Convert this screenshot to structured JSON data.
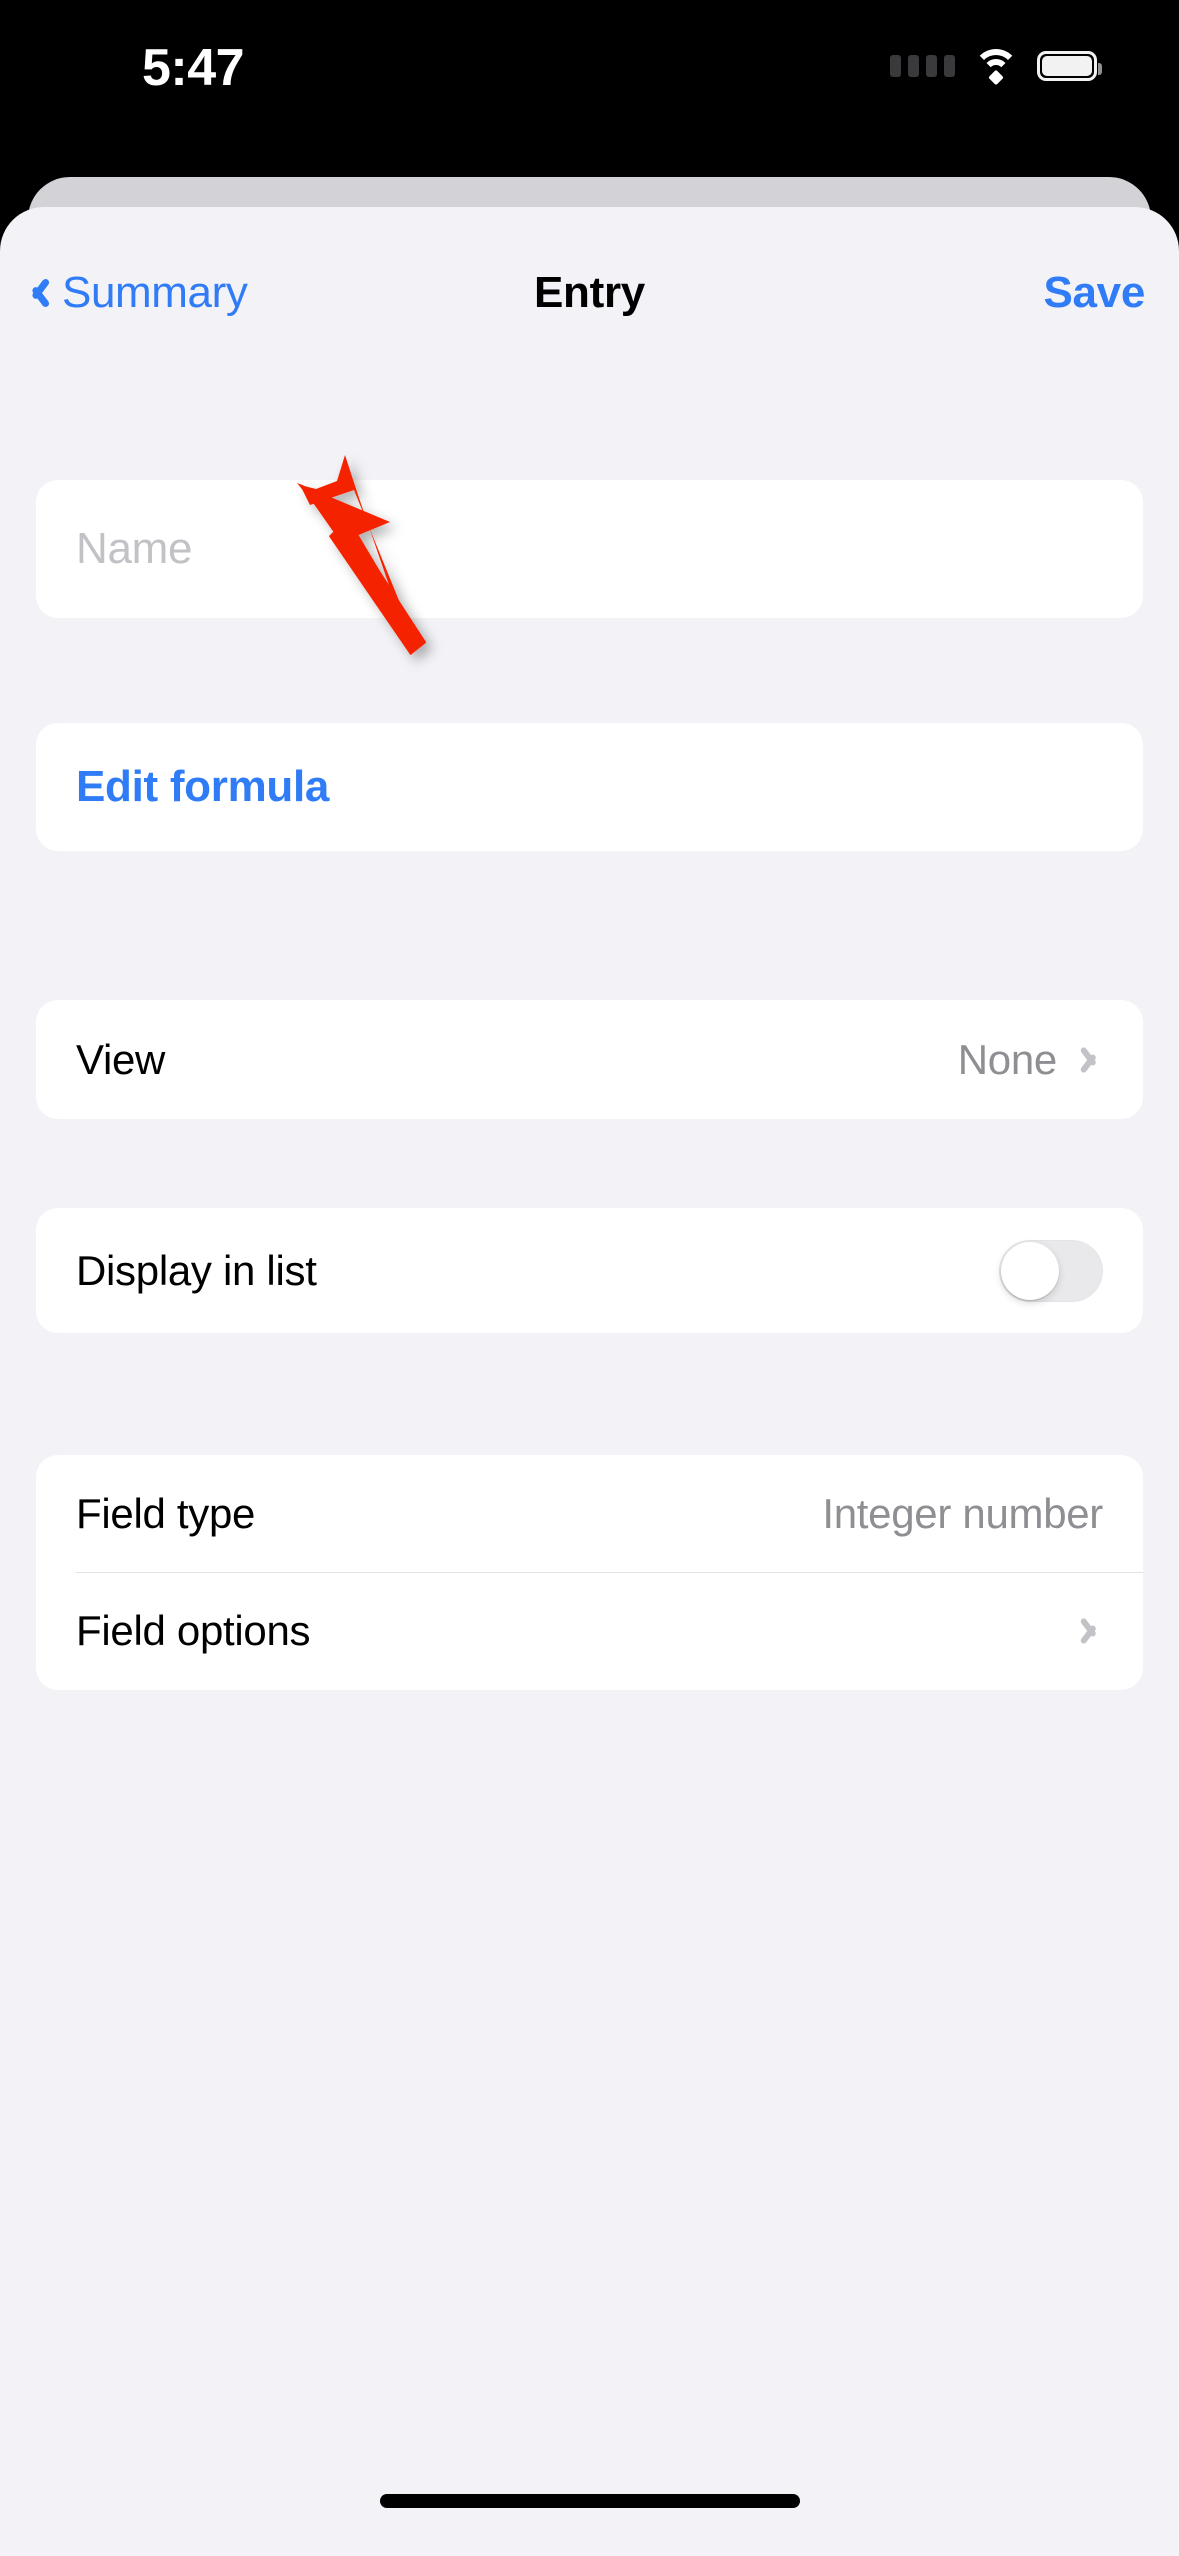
{
  "status_bar": {
    "time": "5:47",
    "signal_icon": "signal-dots-icon",
    "wifi_icon": "wifi-icon",
    "battery_icon": "battery-full-icon"
  },
  "nav": {
    "back_label": "Summary",
    "back_icon": "chevron-left-icon",
    "title": "Entry",
    "save_label": "Save"
  },
  "form": {
    "name_field": {
      "placeholder": "Name",
      "value": ""
    },
    "edit_formula": {
      "label": "Edit formula"
    },
    "view": {
      "label": "View",
      "value": "None",
      "disclosure_icon": "chevron-right-icon"
    },
    "display_in_list": {
      "label": "Display in list",
      "toggle_state": "off"
    },
    "field_type": {
      "label": "Field type",
      "value": "Integer number"
    },
    "field_options": {
      "label": "Field options",
      "disclosure_icon": "chevron-right-icon"
    }
  },
  "annotation": {
    "arrow_color": "#F52306",
    "points_to": "Edit formula"
  },
  "colors": {
    "accent_blue": "#2F7CF6",
    "background": "#F2F2F7",
    "card": "#FFFFFF",
    "secondary_text": "#8E8E93",
    "placeholder_text": "#C2C2C6"
  }
}
